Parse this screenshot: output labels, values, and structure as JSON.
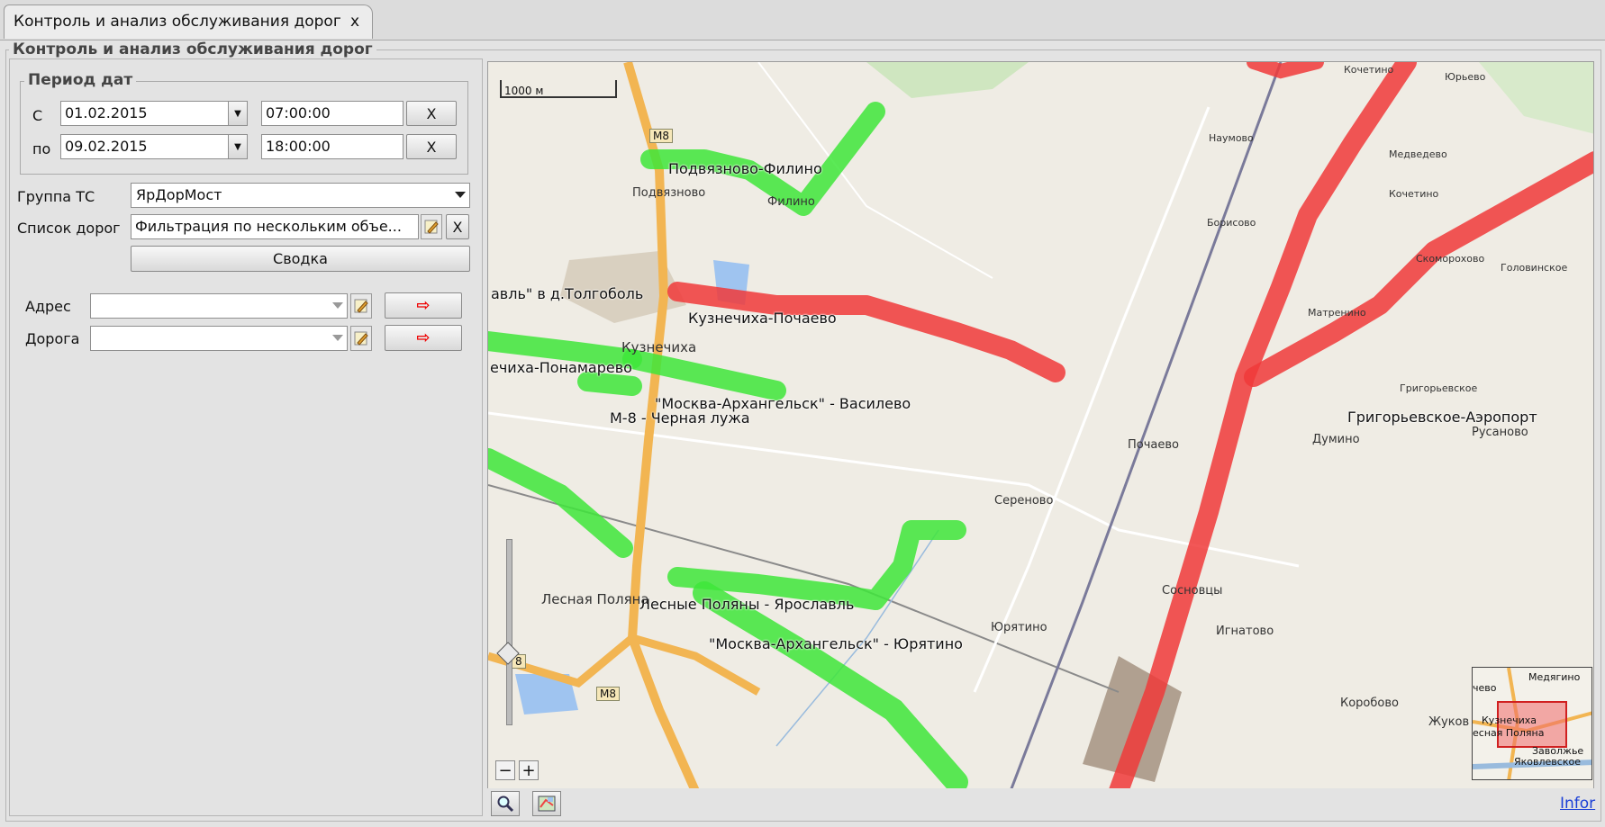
{
  "tab": {
    "title": "Контроль и анализ обслуживания дорог",
    "close": "x"
  },
  "panel": {
    "title": "Контроль и анализ обслуживания дорог",
    "period": {
      "legend": "Период дат",
      "from_label": "С",
      "to_label": "по",
      "from_date": "01.02.2015",
      "from_time": "07:00:00",
      "to_date": "09.02.2015",
      "to_time": "18:00:00",
      "clear_label": "X"
    },
    "group_label": "Группа ТС",
    "group_value": "ЯрДорМост",
    "roads_label": "Список дорог",
    "roads_value": "Фильтрация по нескольким объе...",
    "roads_clear": "X",
    "summary_button": "Сводка",
    "address_label": "Адрес",
    "address_value": "",
    "road_label": "Дорога",
    "road_value": "",
    "go_arrow": "⇨"
  },
  "map": {
    "scale": "1000 м",
    "zoom_out": "−",
    "zoom_in": "+",
    "road_labels": {
      "podvyaznovo_filino": "Подвязново-Филино",
      "kuznechikha_pochaevo": "Кузнечиха-Почаево",
      "kuznechikha_ponamarevo": "ечиха-Понамарево",
      "moskva_vasilevo": "\"Москва-Архангельск\" - Василево",
      "m8_chernaya": "М-8 - Черная лужа",
      "lesnye_polyany": "Лесные Поляны - Ярославль",
      "moskva_yuryatino": "\"Москва-Архангельск\" - Юрятино",
      "grigorevskoe": "Григорьевское-Аэропорт",
      "tolgobol": "авль\" в д.Толгоболь"
    },
    "places": {
      "podvyaznovo": "Подвязново",
      "filino": "Филино",
      "kuznechikha": "Кузнечиха",
      "pochaevo": "Почаево",
      "serenovo": "Сереново",
      "sosnovtsy": "Сосновцы",
      "ignatovo": "Игнатово",
      "yuryatino": "Юрятино",
      "lesnaya": "Лесная Поляна",
      "korobovo": "Коробово",
      "zhukovo": "Жуков",
      "dumino": "Думино",
      "rusanovo": "Русаново",
      "naumovo": "Наумово",
      "borisovo": "Борисово",
      "matrenino": "Матренино",
      "medvedevo": "Медведево",
      "kochetino1": "Кочетино",
      "kochetino2": "Кочетино",
      "yurevo": "Юрьево",
      "skomorokhovo": "Скоморохово",
      "golovinskoe": "Головинское",
      "grigorevskoe": "Григорьевское",
      "m8_shield_1": "М8",
      "m8_shield_2": "М8",
      "m8_shield_3": "8"
    },
    "minimap_labels": {
      "medyagino": "Медягино",
      "kuznechikha": "Кузнечиха",
      "lesnaya": "есная Поляна",
      "zavolzhe": "Заволжье",
      "yakovlevskoe": "Яковлевское",
      "chevo": "чево"
    },
    "colors": {
      "serviced": "#3ee63a",
      "not_serviced": "#f03a3a"
    }
  },
  "toolbar": {
    "info": "Infor"
  }
}
